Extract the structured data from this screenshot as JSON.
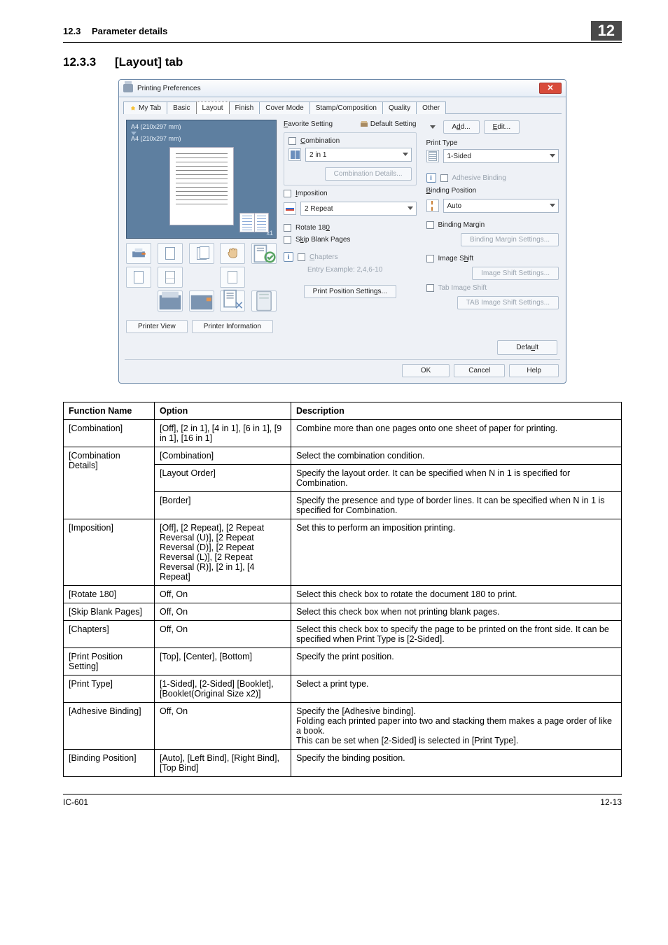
{
  "header": {
    "section_no": "12.3",
    "section_title": "Parameter details",
    "chapter_badge": "12"
  },
  "section": {
    "num": "12.3.3",
    "title": "[Layout] tab"
  },
  "dialog": {
    "title": "Printing Preferences",
    "tabs": [
      "My Tab",
      "Basic",
      "Layout",
      "Finish",
      "Cover Mode",
      "Stamp/Composition",
      "Quality",
      "Other"
    ],
    "selected_tab_index": 2,
    "preview": {
      "size1": "A4 (210x297 mm)",
      "size2": "A4 (210x297 mm)",
      "zoom": "x1"
    },
    "left_buttons": {
      "printer_view": "Printer View",
      "printer_info": "Printer Information"
    },
    "favorite": {
      "label": "Favorite Setting",
      "icon_label": "Default Setting",
      "add": "Add...",
      "edit": "Edit..."
    },
    "combination": {
      "chk_label": "Combination",
      "dd_value": "2 in 1",
      "details_btn": "Combination Details..."
    },
    "imposition": {
      "chk_label": "Imposition",
      "dd_value": "2 Repeat"
    },
    "rotate_label": "Rotate 180",
    "skip_label": "Skip Blank Pages",
    "chapters": {
      "chk_label": "Chapters",
      "hint": "Entry Example: 2,4,6-10"
    },
    "ppos_btn": "Print Position Settings...",
    "print_type": {
      "label": "Print Type",
      "dd_value": "1-Sided"
    },
    "adhesive_label": "Adhesive Binding",
    "bind_pos": {
      "label": "Binding Position",
      "dd_value": "Auto"
    },
    "bind_margin": {
      "chk_label": "Binding Margin",
      "btn": "Binding Margin Settings..."
    },
    "image_shift": {
      "chk_label": "Image Shift",
      "btn": "Image Shift Settings..."
    },
    "tab_shift": {
      "chk_label": "Tab Image Shift",
      "btn": "TAB Image Shift Settings..."
    },
    "default_btn": "Default",
    "ok": "OK",
    "cancel": "Cancel",
    "help": "Help"
  },
  "table": {
    "headers": [
      "Function Name",
      "Option",
      "Description"
    ],
    "rows": [
      {
        "fn": "[Combination]",
        "opt": "[Off], [2 in 1], [4 in 1], [6 in 1], [9 in 1], [16 in 1]",
        "desc": "Combine more than one pages onto one sheet of paper for printing."
      },
      {
        "fn": "[Combination Details]",
        "fn_rowspan": 3,
        "sub": [
          {
            "opt": "[Combination]",
            "desc": "Select the combination condition."
          },
          {
            "opt": "[Layout Order]",
            "desc": "Specify the layout order. It can be specified when N in 1 is specified for Combination."
          },
          {
            "opt": "[Border]",
            "desc": "Specify the presence and type of border lines. It can be specified when N in 1 is specified for Combination."
          }
        ]
      },
      {
        "fn": "[Imposition]",
        "opt": "[Off], [2 Repeat], [2 Repeat Reversal (U)], [2 Repeat Reversal (D)], [2 Repeat Reversal (L)], [2 Repeat Reversal (R)], [2 in 1], [4 Repeat]",
        "desc": "Set this to perform an imposition printing."
      },
      {
        "fn": "[Rotate 180]",
        "opt": "Off, On",
        "desc": "Select this check box to rotate the document 180 to print."
      },
      {
        "fn": "[Skip Blank Pages]",
        "opt": "Off, On",
        "desc": "Select this check box when not printing blank pages."
      },
      {
        "fn": "[Chapters]",
        "opt": "Off, On",
        "desc": "Select this check box to specify the page to be printed on the front side. It can be specified when Print Type is [2-Sided]."
      },
      {
        "fn": "[Print Position Setting]",
        "opt": "[Top], [Center], [Bottom]",
        "desc": "Specify the print position."
      },
      {
        "fn": "[Print Type]",
        "opt": "[1-Sided], [2-Sided] [Booklet], [Booklet(Original Size x2)]",
        "desc": "Select a print type."
      },
      {
        "fn": "[Adhesive Binding]",
        "opt": "Off, On",
        "desc": "Specify the [Adhesive binding].\nFolding each printed paper into two and stacking them makes a page order of like a book.\nThis can be set when [2-Sided] is selected in [Print Type]."
      },
      {
        "fn": "[Binding Position]",
        "opt": "[Auto], [Left Bind], [Right Bind], [Top Bind]",
        "desc": "Specify the binding position."
      }
    ]
  },
  "footer": {
    "left": "IC-601",
    "right": "12-13"
  }
}
